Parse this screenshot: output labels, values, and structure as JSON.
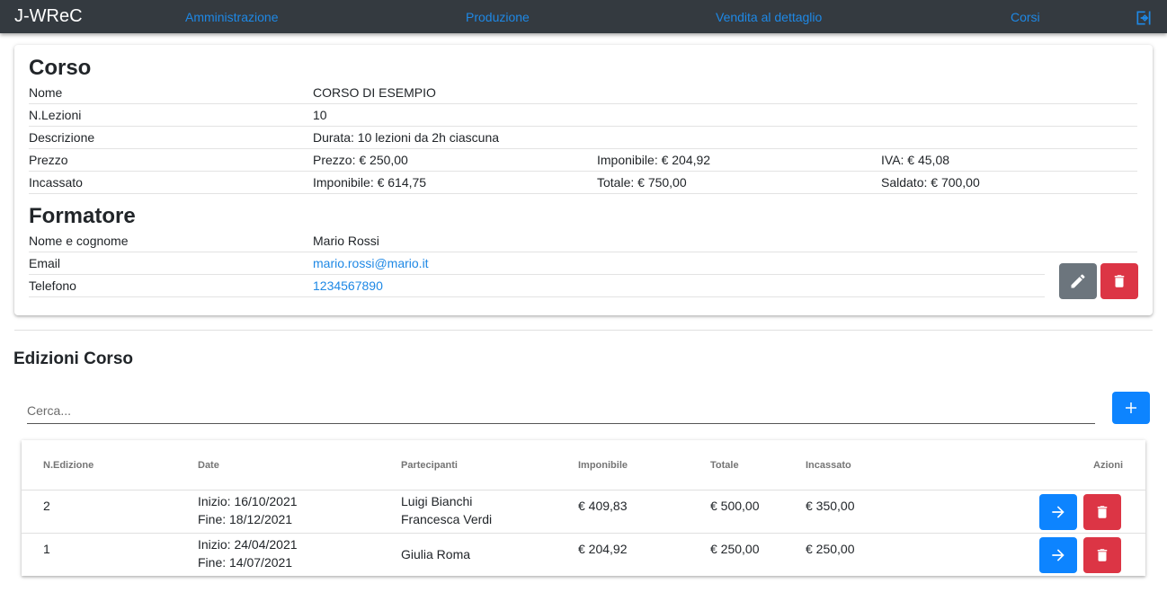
{
  "navbar": {
    "brand": "J-WReC",
    "links": [
      "Amministrazione",
      "Produzione",
      "Vendita al dettaglio",
      "Corsi"
    ],
    "logout_icon": "logout-icon"
  },
  "corso": {
    "title": "Corso",
    "nome_label": "Nome",
    "nome": "CORSO DI ESEMPIO",
    "lezioni_label": "N.Lezioni",
    "lezioni": "10",
    "descrizione_label": "Descrizione",
    "descrizione": "Durata: 10 lezioni da 2h ciascuna",
    "prezzo_label": "Prezzo",
    "prezzo": "Prezzo: € 250,00",
    "prezzo_imponibile": "Imponibile: € 204,92",
    "prezzo_iva": "IVA: € 45,08",
    "incassato_label": "Incassato",
    "incassato_imponibile": "Imponibile: € 614,75",
    "incassato_totale": "Totale: € 750,00",
    "incassato_saldato": "Saldato: € 700,00"
  },
  "formatore": {
    "title": "Formatore",
    "nome_label": "Nome e cognome",
    "nome": "Mario Rossi",
    "email_label": "Email",
    "email": "mario.rossi@mario.it",
    "telefono_label": "Telefono",
    "telefono": "1234567890"
  },
  "edizioni": {
    "title": "Edizioni Corso",
    "search_placeholder": "Cerca...",
    "columns": [
      "N.Edizione",
      "Date",
      "Partecipanti",
      "Imponibile",
      "Totale",
      "Incassato",
      "Azioni"
    ],
    "rows": [
      {
        "numero": "2",
        "inizio": "Inizio: 16/10/2021",
        "fine": "Fine: 18/12/2021",
        "partecipanti": [
          "Luigi Bianchi",
          "Francesca Verdi"
        ],
        "imponibile": "€ 409,83",
        "totale": "€ 500,00",
        "incassato": "€ 350,00"
      },
      {
        "numero": "1",
        "inizio": "Inizio: 24/04/2021",
        "fine": "Fine: 14/07/2021",
        "partecipanti": [
          "Giulia Roma"
        ],
        "imponibile": "€ 204,92",
        "totale": "€ 250,00",
        "incassato": "€ 250,00"
      }
    ]
  },
  "colors": {
    "navbar": "#343a40",
    "link": "#1e88e5",
    "primary": "#0d84ff",
    "danger": "#dc3545",
    "secondary": "#6c757d"
  }
}
